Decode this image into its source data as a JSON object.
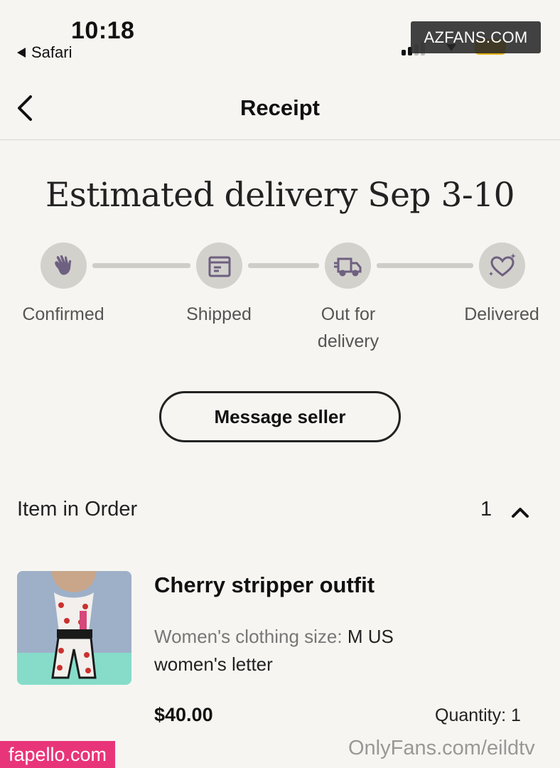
{
  "status_bar": {
    "time": "10:18",
    "back_app": "Safari",
    "battery_color": "#e8b516"
  },
  "watermarks": {
    "top_right": "AZFANS.COM",
    "bottom_left": "fapello.com",
    "bottom_right": "OnlyFans.com/eildtv"
  },
  "nav": {
    "title": "Receipt",
    "back_icon": "chevron-left-icon"
  },
  "delivery": {
    "headline": "Estimated delivery Sep 3-10",
    "steps": [
      {
        "label": "Confirmed",
        "icon": "hand-wave-icon"
      },
      {
        "label": "Shipped",
        "icon": "package-icon"
      },
      {
        "label": "Out for delivery",
        "icon": "delivery-truck-icon"
      },
      {
        "label": "Delivered",
        "icon": "heart-sparkle-icon"
      }
    ],
    "accent_color": "#6e6080",
    "step_bg_color": "#d3d1cc"
  },
  "actions": {
    "message_seller": "Message seller"
  },
  "order": {
    "section_title": "Item in Order",
    "count": "1",
    "items": [
      {
        "title": "Cherry stripper outfit",
        "attribute_label": "Women's clothing size:",
        "attribute_value": "M US women's letter",
        "price": "$40.00",
        "quantity": "Quantity: 1"
      }
    ]
  }
}
